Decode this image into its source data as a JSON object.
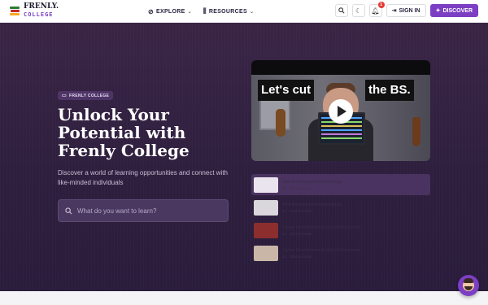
{
  "brand": {
    "name_top": "FRENLY.",
    "name_bottom": "COLLEGE"
  },
  "nav": [
    {
      "label": "EXPLORE",
      "icon": "compass-icon"
    },
    {
      "label": "RESOURCES",
      "icon": "library-icon"
    }
  ],
  "actions": {
    "notification_count": "1",
    "signin_label": "SIGN IN",
    "discover_label": "DISCOVER"
  },
  "hero": {
    "tag": "FRENLY COLLEGE",
    "headline": "Unlock Your Potential with Frenly College",
    "subtitle": "Discover a world of learning opportunities and connect with like-minded individuals",
    "search_placeholder": "What do you want to learn?"
  },
  "video": {
    "caption_left": "Let's cut",
    "caption_right": "the BS."
  },
  "playlist": [
    {
      "title": "Web Development Fundamentals",
      "meta": "12 · Shorted video",
      "active": true,
      "thumb": "#e9e4ee"
    },
    {
      "title": "Web Development Fundamentals",
      "meta": "12 · Shorted video",
      "active": false,
      "thumb": "#d9d6dc"
    },
    {
      "title": "Career Development for Web Professionals",
      "meta": "12 · Shorted video",
      "active": false,
      "thumb": "#8c2e2e"
    },
    {
      "title": "Career Development for Web Professionals",
      "meta": "12 · Shorted video",
      "active": false,
      "thumb": "#c9b6a6"
    }
  ],
  "colors": {
    "accent": "#7c3fc4",
    "hero_bg": "#2f1f3f"
  }
}
